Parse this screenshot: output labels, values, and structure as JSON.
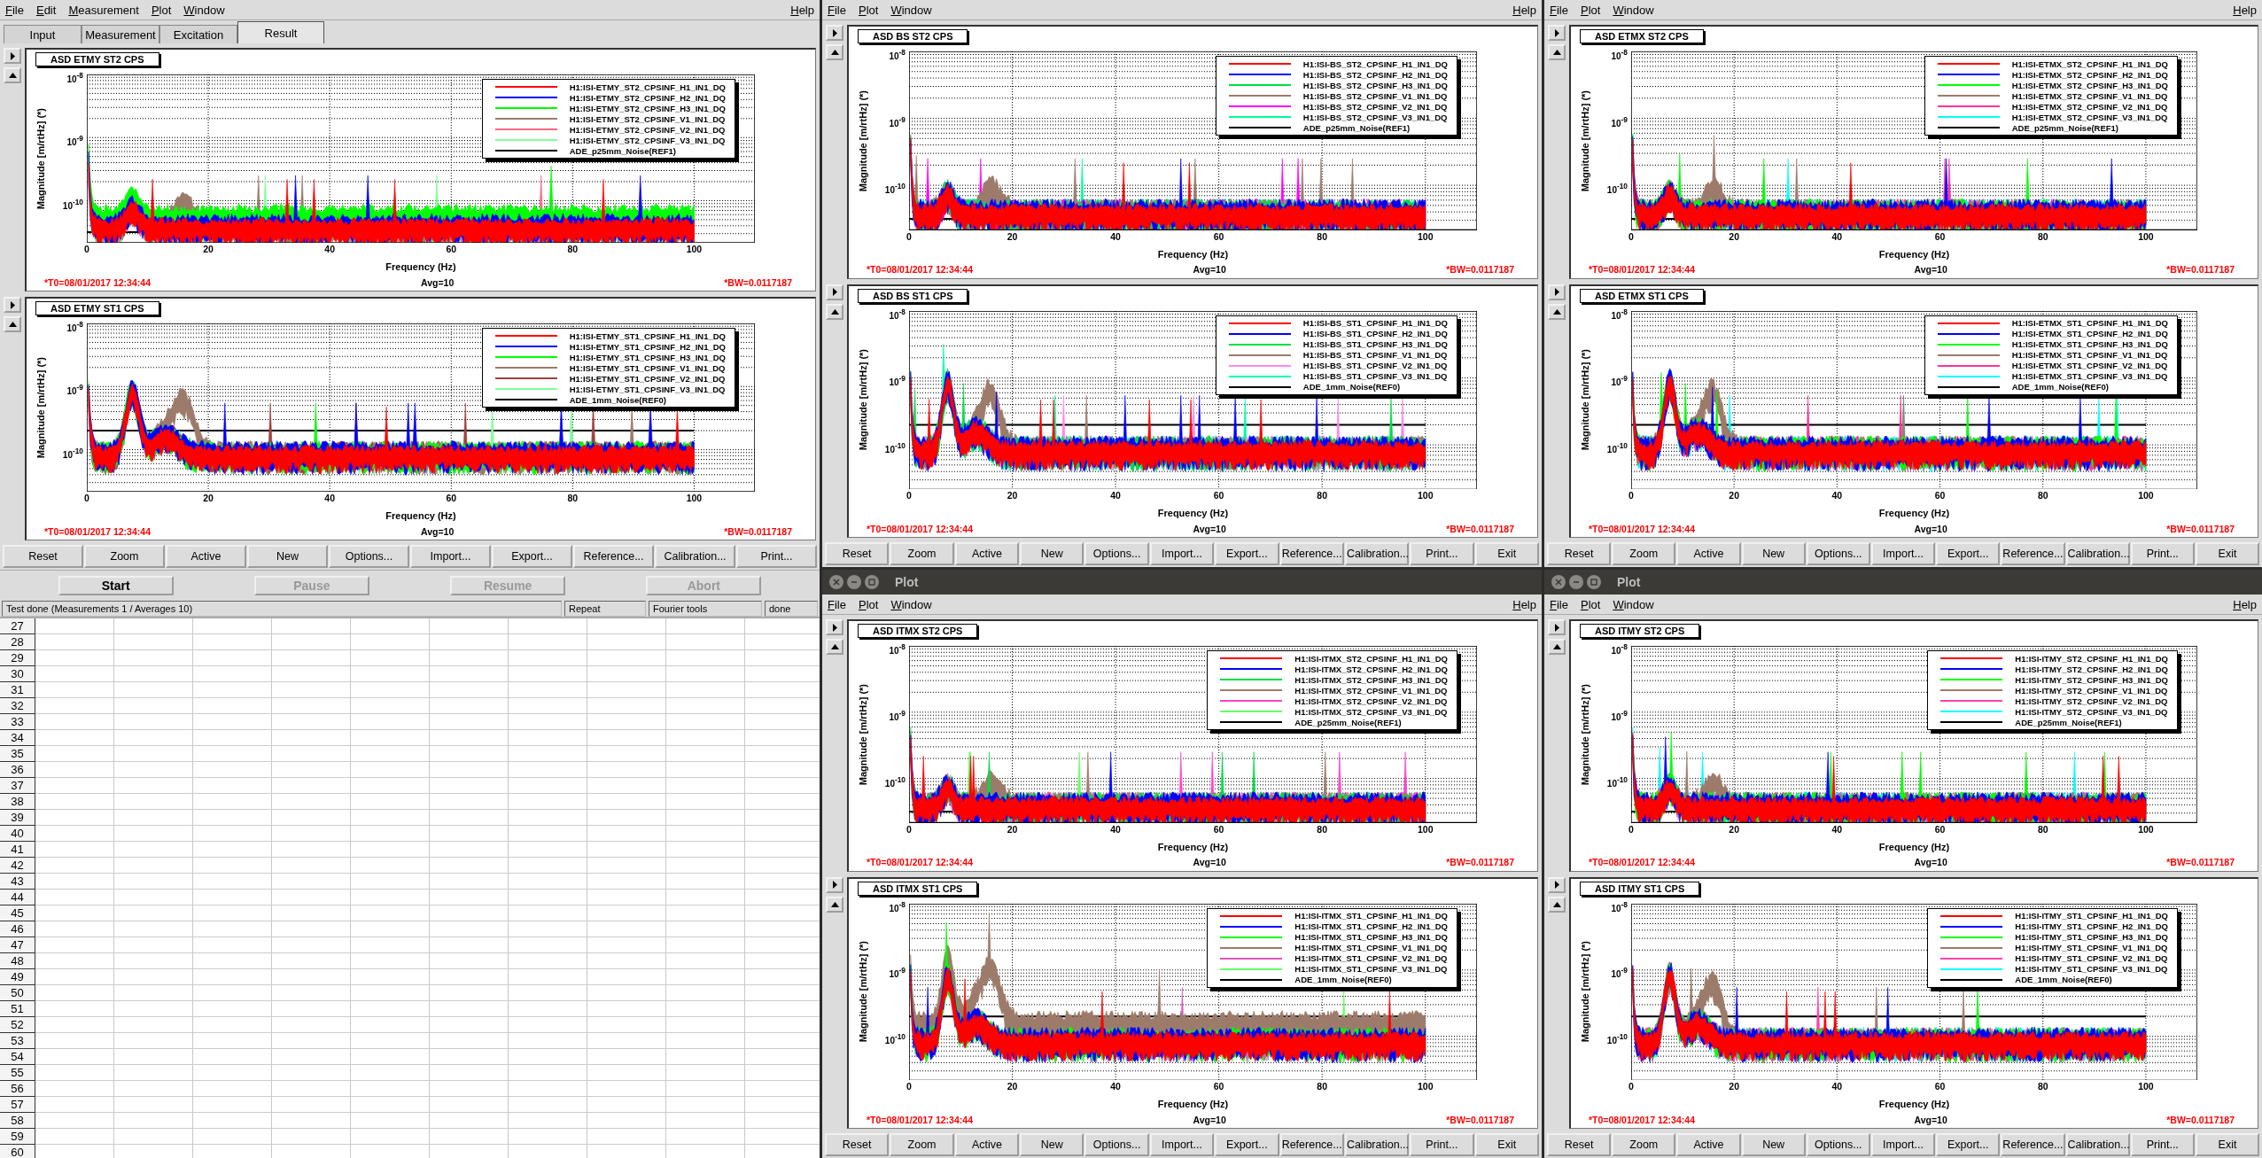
{
  "main_window": {
    "menu": [
      "File",
      "Edit",
      "Measurement",
      "Plot",
      "Window"
    ],
    "help_menu": "Help",
    "tabs": [
      {
        "label": "Input",
        "selected": false
      },
      {
        "label": "Measurement",
        "selected": false
      },
      {
        "label": "Excitation",
        "selected": false
      },
      {
        "label": "Result",
        "selected": true
      }
    ],
    "plots": [
      {
        "title": "ASD ETMY ST2 CPS",
        "ylabel": "Magnitude [m/rtHz] (*)",
        "xlabel": "Frequency (Hz)",
        "yticks": [
          "10$^{-8}$",
          "10$^{-9}$",
          "10$^{-10}$"
        ],
        "xticks": [
          "0",
          "20",
          "40",
          "60",
          "80",
          "100"
        ],
        "t0": "*T0=08/01/2017 12:34:44",
        "avg": "Avg=10",
        "bw": "*BW=0.0117187",
        "legend": [
          {
            "label": "H1:ISI-ETMY_ST2_CPSINF_H1_IN1_DQ",
            "color": "#ff0000"
          },
          {
            "label": "H1:ISI-ETMY_ST2_CPSINF_H2_IN1_DQ",
            "color": "#0000ff"
          },
          {
            "label": "H1:ISI-ETMY_ST2_CPSINF_H3_IN1_DQ",
            "color": "#00ff00"
          },
          {
            "label": "H1:ISI-ETMY_ST2_CPSINF_V1_IN1_DQ",
            "color": "#9c7b6a"
          },
          {
            "label": "H1:ISI-ETMY_ST2_CPSINF_V2_IN1_DQ",
            "color": "#ff6680"
          },
          {
            "label": "H1:ISI-ETMY_ST2_CPSINF_V3_IN1_DQ",
            "color": "#80ff99"
          },
          {
            "label": "ADE_p25mm_Noise(REF1)",
            "color": "#000000"
          }
        ]
      },
      {
        "title": "ASD ETMY ST1 CPS",
        "ylabel": "Magnitude [m/rtHz] (*)",
        "xlabel": "Frequency (Hz)",
        "yticks": [
          "10$^{-8}$",
          "10$^{-9}$",
          "10$^{-10}$"
        ],
        "xticks": [
          "0",
          "20",
          "40",
          "60",
          "80",
          "100"
        ],
        "t0": "*T0=08/01/2017 12:34:44",
        "avg": "Avg=10",
        "bw": "*BW=0.0117187",
        "legend": [
          {
            "label": "H1:ISI-ETMY_ST1_CPSINF_H1_IN1_DQ",
            "color": "#ff0000"
          },
          {
            "label": "H1:ISI-ETMY_ST1_CPSINF_H2_IN1_DQ",
            "color": "#0000ff"
          },
          {
            "label": "H1:ISI-ETMY_ST1_CPSINF_H3_IN1_DQ",
            "color": "#00ff00"
          },
          {
            "label": "H1:ISI-ETMY_ST1_CPSINF_V1_IN1_DQ",
            "color": "#9c7b6a"
          },
          {
            "label": "H1:ISI-ETMY_ST1_CPSINF_V2_IN1_DQ",
            "color": "#a04040"
          },
          {
            "label": "H1:ISI-ETMY_ST1_CPSINF_V3_IN1_DQ",
            "color": "#80ff99"
          },
          {
            "label": "ADE_1mm_Noise(REF0)",
            "color": "#000000"
          }
        ]
      }
    ],
    "buttons": [
      "Reset",
      "Zoom",
      "Active",
      "New",
      "Options...",
      "Import...",
      "Export...",
      "Reference...",
      "Calibration...",
      "Print..."
    ],
    "run_buttons": [
      {
        "label": "Start",
        "disabled": false
      },
      {
        "label": "Pause",
        "disabled": true
      },
      {
        "label": "Resume",
        "disabled": true
      },
      {
        "label": "Abort",
        "disabled": true
      }
    ],
    "status": {
      "message": "Test done (Measurements 1 / Averages 10)",
      "fields": [
        "Repeat",
        "Fourier tools",
        "done"
      ]
    },
    "table": {
      "row_numbers": [
        "27",
        "28",
        "29",
        "30",
        "31",
        "32",
        "33",
        "34",
        "35",
        "36",
        "37",
        "38",
        "39",
        "40",
        "41",
        "42",
        "43",
        "44",
        "45",
        "46",
        "47",
        "48",
        "49",
        "50",
        "51",
        "52",
        "53",
        "54",
        "55",
        "56",
        "57",
        "58",
        "59",
        "60"
      ]
    }
  },
  "plot_windows": [
    {
      "menu": [
        "File",
        "Plot",
        "Window"
      ],
      "help_menu": "Help",
      "plots": [
        {
          "title": "ASD BS ST2 CPS",
          "ylabel": "Magnitude [m/rtHz] (*)",
          "xlabel": "Frequency (Hz)",
          "yticks": [
            "10$^{-8}$",
            "10$^{-9}$",
            "10$^{-10}$"
          ],
          "xticks": [
            "0",
            "20",
            "40",
            "60",
            "80",
            "100"
          ],
          "t0": "*T0=08/01/2017 12:34:44",
          "avg": "Avg=10",
          "bw": "*BW=0.0117187",
          "legend": [
            {
              "label": "H1:ISI-BS_ST2_CPSINF_H1_IN1_DQ",
              "color": "#ff0000"
            },
            {
              "label": "H1:ISI-BS_ST2_CPSINF_H2_IN1_DQ",
              "color": "#0000ff"
            },
            {
              "label": "H1:ISI-BS_ST2_CPSINF_H3_IN1_DQ",
              "color": "#00dd44"
            },
            {
              "label": "H1:ISI-BS_ST2_CPSINF_V1_IN1_DQ",
              "color": "#9c7b6a"
            },
            {
              "label": "H1:ISI-BS_ST2_CPSINF_V2_IN1_DQ",
              "color": "#ff00ff"
            },
            {
              "label": "H1:ISI-BS_ST2_CPSINF_V3_IN1_DQ",
              "color": "#00ff99"
            },
            {
              "label": "ADE_p25mm_Noise(REF1)",
              "color": "#000000"
            }
          ]
        },
        {
          "title": "ASD BS ST1 CPS",
          "ylabel": "Magnitude [m/rtHz] (*)",
          "xlabel": "Frequency (Hz)",
          "yticks": [
            "10$^{-8}$",
            "10$^{-9}$",
            "10$^{-10}$"
          ],
          "xticks": [
            "0",
            "20",
            "40",
            "60",
            "80",
            "100"
          ],
          "t0": "*T0=08/01/2017 12:34:44",
          "avg": "Avg=10",
          "bw": "*BW=0.0117187",
          "legend": [
            {
              "label": "H1:ISI-BS_ST1_CPSINF_H1_IN1_DQ",
              "color": "#ff0000"
            },
            {
              "label": "H1:ISI-BS_ST1_CPSINF_H2_IN1_DQ",
              "color": "#0000ff"
            },
            {
              "label": "H1:ISI-BS_ST1_CPSINF_H3_IN1_DQ",
              "color": "#00dd44"
            },
            {
              "label": "H1:ISI-BS_ST1_CPSINF_V1_IN1_DQ",
              "color": "#9c7b6a"
            },
            {
              "label": "H1:ISI-BS_ST1_CPSINF_V2_IN1_DQ",
              "color": "#ff88ee"
            },
            {
              "label": "H1:ISI-BS_ST1_CPSINF_V3_IN1_DQ",
              "color": "#00ffaa"
            },
            {
              "label": "ADE_1mm_Noise(REF0)",
              "color": "#000000"
            }
          ]
        }
      ],
      "buttons": [
        "Reset",
        "Zoom",
        "Active",
        "New",
        "Options...",
        "Import...",
        "Export...",
        "Reference...",
        "Calibration...",
        "Print...",
        "Exit"
      ]
    },
    {
      "menu": [
        "File",
        "Plot",
        "Window"
      ],
      "help_menu": "Help",
      "plots": [
        {
          "title": "ASD ETMX ST2 CPS",
          "ylabel": "Magnitude [m/rtHz] (*)",
          "xlabel": "Frequency (Hz)",
          "yticks": [
            "10$^{-8}$",
            "10$^{-9}$",
            "10$^{-10}$"
          ],
          "xticks": [
            "0",
            "20",
            "40",
            "60",
            "80",
            "100"
          ],
          "t0": "*T0=08/01/2017 12:34:44",
          "avg": "Avg=10",
          "bw": "*BW=0.0117187",
          "legend": [
            {
              "label": "H1:ISI-ETMX_ST2_CPSINF_H1_IN1_DQ",
              "color": "#ff0000"
            },
            {
              "label": "H1:ISI-ETMX_ST2_CPSINF_H2_IN1_DQ",
              "color": "#0000ff"
            },
            {
              "label": "H1:ISI-ETMX_ST2_CPSINF_H3_IN1_DQ",
              "color": "#00ff00"
            },
            {
              "label": "H1:ISI-ETMX_ST2_CPSINF_V1_IN1_DQ",
              "color": "#9c7b6a"
            },
            {
              "label": "H1:ISI-ETMX_ST2_CPSINF_V2_IN1_DQ",
              "color": "#ff3399"
            },
            {
              "label": "H1:ISI-ETMX_ST2_CPSINF_V3_IN1_DQ",
              "color": "#00ffff"
            },
            {
              "label": "ADE_p25mm_Noise(REF1)",
              "color": "#000000"
            }
          ]
        },
        {
          "title": "ASD ETMX ST1 CPS",
          "ylabel": "Magnitude [m/rtHz] (*)",
          "xlabel": "Frequency (Hz)",
          "yticks": [
            "10$^{-8}$",
            "10$^{-9}$",
            "10$^{-10}$"
          ],
          "xticks": [
            "0",
            "20",
            "40",
            "60",
            "80",
            "100"
          ],
          "t0": "*T0=08/01/2017 12:34:44",
          "avg": "Avg=10",
          "bw": "*BW=0.0117187",
          "legend": [
            {
              "label": "H1:ISI-ETMX_ST1_CPSINF_H1_IN1_DQ",
              "color": "#ff0000"
            },
            {
              "label": "H1:ISI-ETMX_ST1_CPSINF_H2_IN1_DQ",
              "color": "#0000ff"
            },
            {
              "label": "H1:ISI-ETMX_ST1_CPSINF_H3_IN1_DQ",
              "color": "#00ff00"
            },
            {
              "label": "H1:ISI-ETMX_ST1_CPSINF_V1_IN1_DQ",
              "color": "#9c7b6a"
            },
            {
              "label": "H1:ISI-ETMX_ST1_CPSINF_V2_IN1_DQ",
              "color": "#ff3399"
            },
            {
              "label": "H1:ISI-ETMX_ST1_CPSINF_V3_IN1_DQ",
              "color": "#00ffff"
            },
            {
              "label": "ADE_1mm_Noise(REF0)",
              "color": "#000000"
            }
          ]
        }
      ],
      "buttons": [
        "Reset",
        "Zoom",
        "Active",
        "New",
        "Options...",
        "Import...",
        "Export...",
        "Reference...",
        "Calibration...",
        "Print...",
        "Exit"
      ]
    },
    {
      "title": "Plot",
      "menu": [
        "File",
        "Plot",
        "Window"
      ],
      "help_menu": "Help",
      "plots": [
        {
          "title": "ASD ITMX ST2 CPS",
          "ylabel": "Magnitude [m/rtHz] (*)",
          "xlabel": "Frequency (Hz)",
          "yticks": [
            "10$^{-8}$",
            "10$^{-9}$",
            "10$^{-10}$"
          ],
          "xticks": [
            "0",
            "20",
            "40",
            "60",
            "80",
            "100"
          ],
          "t0": "*T0=08/01/2017 12:34:44",
          "avg": "Avg=10",
          "bw": "*BW=0.0117187",
          "legend": [
            {
              "label": "H1:ISI-ITMX_ST2_CPSINF_H1_IN1_DQ",
              "color": "#ff0000"
            },
            {
              "label": "H1:ISI-ITMX_ST2_CPSINF_H2_IN1_DQ",
              "color": "#0000ff"
            },
            {
              "label": "H1:ISI-ITMX_ST2_CPSINF_H3_IN1_DQ",
              "color": "#00dd44"
            },
            {
              "label": "H1:ISI-ITMX_ST2_CPSINF_V1_IN1_DQ",
              "color": "#9c7b6a"
            },
            {
              "label": "H1:ISI-ITMX_ST2_CPSINF_V2_IN1_DQ",
              "color": "#ff44cc"
            },
            {
              "label": "H1:ISI-ITMX_ST2_CPSINF_V3_IN1_DQ",
              "color": "#66ff66"
            },
            {
              "label": "ADE_p25mm_Noise(REF1)",
              "color": "#000000"
            }
          ]
        },
        {
          "title": "ASD ITMX ST1 CPS",
          "ylabel": "Magnitude [m/rtHz] (*)",
          "xlabel": "Frequency (Hz)",
          "yticks": [
            "10$^{-8}$",
            "10$^{-9}$",
            "10$^{-10}$"
          ],
          "xticks": [
            "0",
            "20",
            "40",
            "60",
            "80",
            "100"
          ],
          "t0": "*T0=08/01/2017 12:34:44",
          "avg": "Avg=10",
          "bw": "*BW=0.0117187",
          "legend": [
            {
              "label": "H1:ISI-ITMX_ST1_CPSINF_H1_IN1_DQ",
              "color": "#ff0000"
            },
            {
              "label": "H1:ISI-ITMX_ST1_CPSINF_H2_IN1_DQ",
              "color": "#0000ff"
            },
            {
              "label": "H1:ISI-ITMX_ST1_CPSINF_H3_IN1_DQ",
              "color": "#00ff00"
            },
            {
              "label": "H1:ISI-ITMX_ST1_CPSINF_V1_IN1_DQ",
              "color": "#9c7b6a"
            },
            {
              "label": "H1:ISI-ITMX_ST1_CPSINF_V2_IN1_DQ",
              "color": "#dd55bb"
            },
            {
              "label": "H1:ISI-ITMX_ST1_CPSINF_V3_IN1_DQ",
              "color": "#66ff66"
            },
            {
              "label": "ADE_1mm_Noise(REF0)",
              "color": "#000000"
            }
          ]
        }
      ],
      "buttons": [
        "Reset",
        "Zoom",
        "Active",
        "New",
        "Options...",
        "Import...",
        "Export...",
        "Reference...",
        "Calibration...",
        "Print...",
        "Exit"
      ]
    },
    {
      "title": "Plot",
      "menu": [
        "File",
        "Plot",
        "Window"
      ],
      "help_menu": "Help",
      "plots": [
        {
          "title": "ASD ITMY ST2 CPS",
          "ylabel": "Magnitude [m/rtHz] (*)",
          "xlabel": "Frequency (Hz)",
          "yticks": [
            "10$^{-8}$",
            "10$^{-9}$",
            "10$^{-10}$"
          ],
          "xticks": [
            "0",
            "20",
            "40",
            "60",
            "80",
            "100"
          ],
          "t0": "*T0=08/01/2017 12:34:44",
          "avg": "Avg=10",
          "bw": "*BW=0.0117187",
          "legend": [
            {
              "label": "H1:ISI-ITMY_ST2_CPSINF_H1_IN1_DQ",
              "color": "#ff0000"
            },
            {
              "label": "H1:ISI-ITMY_ST2_CPSINF_H2_IN1_DQ",
              "color": "#0000ff"
            },
            {
              "label": "H1:ISI-ITMY_ST2_CPSINF_H3_IN1_DQ",
              "color": "#00ff00"
            },
            {
              "label": "H1:ISI-ITMY_ST2_CPSINF_V1_IN1_DQ",
              "color": "#9c7b6a"
            },
            {
              "label": "H1:ISI-ITMY_ST2_CPSINF_V2_IN1_DQ",
              "color": "#ff44aa"
            },
            {
              "label": "H1:ISI-ITMY_ST2_CPSINF_V3_IN1_DQ",
              "color": "#00ffff"
            },
            {
              "label": "ADE_p25mm_Noise(REF1)",
              "color": "#000000"
            }
          ]
        },
        {
          "title": "ASD ITMY ST1 CPS",
          "ylabel": "Magnitude [m/rtHz] (*)",
          "xlabel": "Frequency (Hz)",
          "yticks": [
            "10$^{-8}$",
            "10$^{-9}$",
            "10$^{-10}$"
          ],
          "xticks": [
            "0",
            "20",
            "40",
            "60",
            "80",
            "100"
          ],
          "t0": "*T0=08/01/2017 12:34:44",
          "avg": "Avg=10",
          "bw": "*BW=0.0117187",
          "legend": [
            {
              "label": "H1:ISI-ITMY_ST1_CPSINF_H1_IN1_DQ",
              "color": "#ff0000"
            },
            {
              "label": "H1:ISI-ITMY_ST1_CPSINF_H2_IN1_DQ",
              "color": "#0000ff"
            },
            {
              "label": "H1:ISI-ITMY_ST1_CPSINF_H3_IN1_DQ",
              "color": "#00ff00"
            },
            {
              "label": "H1:ISI-ITMY_ST1_CPSINF_V1_IN1_DQ",
              "color": "#9c7b6a"
            },
            {
              "label": "H1:ISI-ITMY_ST1_CPSINF_V2_IN1_DQ",
              "color": "#ff44aa"
            },
            {
              "label": "H1:ISI-ITMY_ST1_CPSINF_V3_IN1_DQ",
              "color": "#00ffff"
            },
            {
              "label": "ADE_1mm_Noise(REF0)",
              "color": "#000000"
            }
          ]
        }
      ],
      "buttons": [
        "Reset",
        "Zoom",
        "Active",
        "New",
        "Options...",
        "Import...",
        "Export...",
        "Reference...",
        "Calibration...",
        "Print...",
        "Exit"
      ]
    }
  ]
}
